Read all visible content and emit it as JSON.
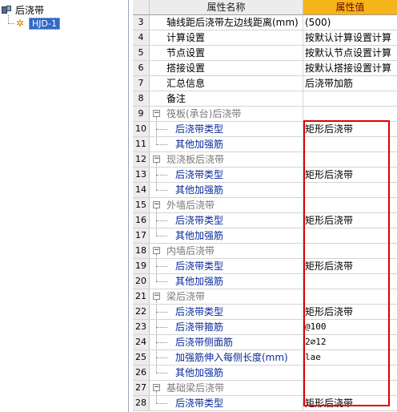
{
  "tree": {
    "root_label": "后浇带",
    "child_label": "HJD-1"
  },
  "grid": {
    "header_name": "属性名称",
    "header_value": "属性值",
    "rows": [
      {
        "num": "3",
        "name": "轴线距后浇带左边线距离(mm)",
        "value": "(500)",
        "kind": "top"
      },
      {
        "num": "4",
        "name": "计算设置",
        "value": "按默认计算设置计算",
        "kind": "top"
      },
      {
        "num": "5",
        "name": "节点设置",
        "value": "按默认节点设置计算",
        "kind": "top"
      },
      {
        "num": "6",
        "name": "搭接设置",
        "value": "按默认搭接设置计算",
        "kind": "top"
      },
      {
        "num": "7",
        "name": "汇总信息",
        "value": "后浇带加筋",
        "kind": "top"
      },
      {
        "num": "8",
        "name": "备注",
        "value": "",
        "kind": "top"
      },
      {
        "num": "9",
        "name": "筏板(承台)后浇带",
        "value": "",
        "kind": "group"
      },
      {
        "num": "10",
        "name": "后浇带类型",
        "value": "矩形后浇带",
        "kind": "child"
      },
      {
        "num": "11",
        "name": "其他加强筋",
        "value": "",
        "kind": "child"
      },
      {
        "num": "12",
        "name": "现浇板后浇带",
        "value": "",
        "kind": "group"
      },
      {
        "num": "13",
        "name": "后浇带类型",
        "value": "矩形后浇带",
        "kind": "child"
      },
      {
        "num": "14",
        "name": "其他加强筋",
        "value": "",
        "kind": "child"
      },
      {
        "num": "15",
        "name": "外墙后浇带",
        "value": "",
        "kind": "group"
      },
      {
        "num": "16",
        "name": "后浇带类型",
        "value": "矩形后浇带",
        "kind": "child"
      },
      {
        "num": "17",
        "name": "其他加强筋",
        "value": "",
        "kind": "child"
      },
      {
        "num": "18",
        "name": "内墙后浇带",
        "value": "",
        "kind": "group"
      },
      {
        "num": "19",
        "name": "后浇带类型",
        "value": "矩形后浇带",
        "kind": "child"
      },
      {
        "num": "20",
        "name": "其他加强筋",
        "value": "",
        "kind": "child"
      },
      {
        "num": "21",
        "name": "梁后浇带",
        "value": "",
        "kind": "group"
      },
      {
        "num": "22",
        "name": "后浇带类型",
        "value": "矩形后浇带",
        "kind": "child"
      },
      {
        "num": "23",
        "name": "后浇带箍筋",
        "value": "@100",
        "kind": "child"
      },
      {
        "num": "24",
        "name": "后浇带侧面筋",
        "value": "2⌀12",
        "kind": "child"
      },
      {
        "num": "25",
        "name": "加强筋伸入每侧长度(mm)",
        "value": "lae",
        "kind": "child"
      },
      {
        "num": "26",
        "name": "其他加强筋",
        "value": "",
        "kind": "child"
      },
      {
        "num": "27",
        "name": "基础梁后浇带",
        "value": "",
        "kind": "group"
      },
      {
        "num": "28",
        "name": "后浇带类型",
        "value": "矩形后浇带",
        "kind": "child"
      }
    ]
  },
  "colors": {
    "header_value_bg": "#f4b41a",
    "highlight_box": "#e00000",
    "child_text": "#0a2a9a",
    "group_text": "#7a7a7a"
  }
}
